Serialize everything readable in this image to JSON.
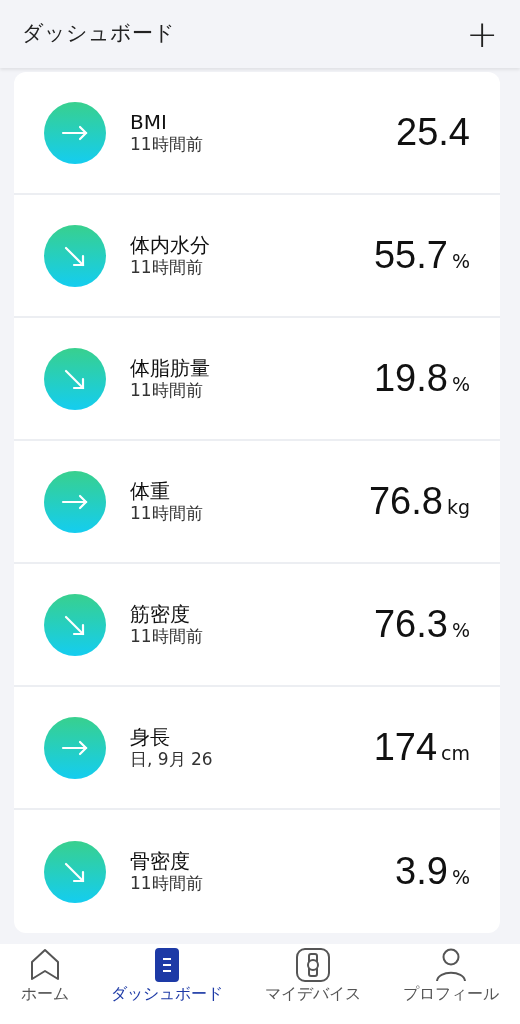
{
  "header": {
    "title": "ダッシュボード",
    "add_button": "+"
  },
  "metrics": [
    {
      "name": "BMI",
      "time": "11時間前",
      "value": "25.4",
      "kind": "flat"
    },
    {
      "name": "体内水分",
      "time": "11時間前",
      "value": "55.7",
      "unit": "%",
      "kind": "down"
    },
    {
      "name": "体脂肪量",
      "time": "11時間前",
      "value": "19.8",
      "unit": "%",
      "kind": "down"
    },
    {
      "name": "体重",
      "time": "11時間前",
      "value": "76.8",
      "unit": "kg",
      "kind": "flat"
    },
    {
      "name": "筋密度",
      "time": "11時間前",
      "value": "76.3",
      "unit": "%",
      "kind": "down"
    },
    {
      "name": "身長",
      "time": "日, 9月 26",
      "value": "174",
      "unit": "cm",
      "kind": "flat"
    },
    {
      "name": "骨密度",
      "time": "11時間前",
      "value": "3.9",
      "unit": "%",
      "kind": "down"
    }
  ],
  "bottom_nav": [
    {
      "label": "ホーム",
      "selected": false
    },
    {
      "label": "ダッシュボード",
      "selected": true
    },
    {
      "label": "マイデバイス",
      "selected": false
    },
    {
      "label": "プロフィール",
      "selected": false
    }
  ]
}
